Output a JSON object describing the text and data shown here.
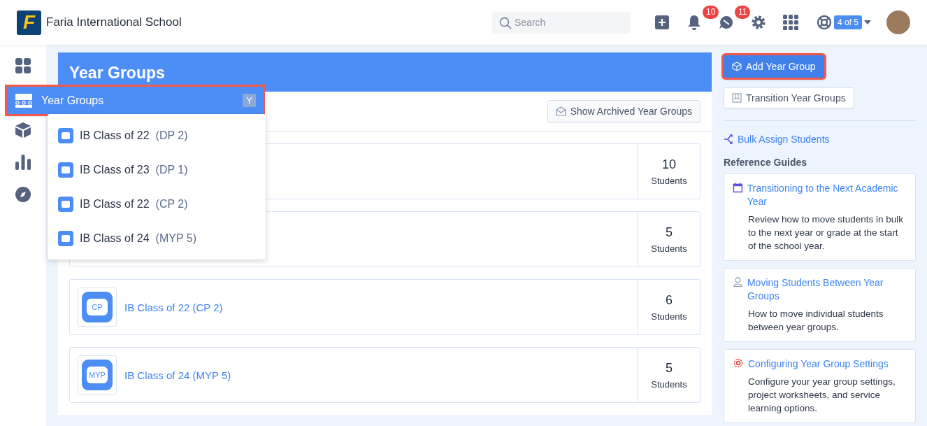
{
  "header": {
    "logo_letter": "F",
    "school_name": "Faria International School",
    "search": {
      "placeholder": "Search"
    },
    "notifications": {
      "count": "10"
    },
    "messages": {
      "count": "11"
    },
    "help": {
      "badge": "4 of 5"
    }
  },
  "page": {
    "title": "Year Groups",
    "archived_button": "Show Archived Year Groups",
    "rows": [
      {
        "count": "10",
        "unit": "Students"
      },
      {
        "count": "5",
        "unit": "Students"
      },
      {
        "name": "IB Class of 22 (CP 2)",
        "badge": "CP",
        "count": "6",
        "unit": "Students"
      },
      {
        "name": "IB Class of 24 (MYP 5)",
        "badge": "MYP",
        "count": "5",
        "unit": "Students"
      }
    ]
  },
  "flyout": {
    "title": "Year Groups",
    "shortcut": "Y",
    "highlighted": true,
    "items": [
      {
        "name": "IB Class of 22",
        "code": "(DP 2)"
      },
      {
        "name": "IB Class of 23",
        "code": "(DP 1)"
      },
      {
        "name": "IB Class of 22",
        "code": "(CP 2)"
      },
      {
        "name": "IB Class of 24",
        "code": "(MYP 5)"
      }
    ]
  },
  "actions": {
    "add_button": {
      "label": "Add Year Group",
      "highlighted": true
    },
    "transition_button": "Transition Year Groups",
    "bulk_link": "Bulk Assign Students"
  },
  "reference_guides": {
    "heading": "Reference Guides",
    "guides": [
      {
        "kind": "calendar",
        "title": "Transitioning to the Next Academic Year",
        "description": "Review how to move students in bulk to the next year or grade at the start of the school year."
      },
      {
        "kind": "person",
        "title": "Moving Students Between Year Groups",
        "description": "How to move individual students between year groups."
      },
      {
        "kind": "gear",
        "title": "Configuring Year Group Settings",
        "description": "Configure your year group settings, project worksheets, and service learning options."
      }
    ]
  }
}
